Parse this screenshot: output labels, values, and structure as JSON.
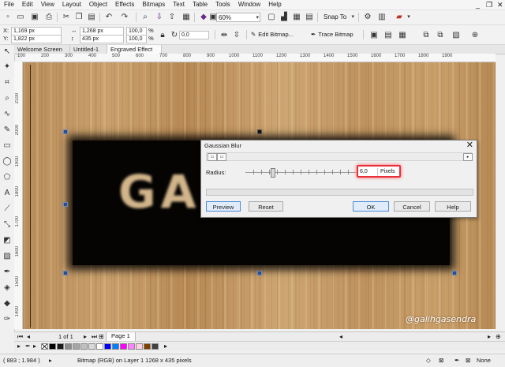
{
  "menu": [
    "File",
    "Edit",
    "View",
    "Layout",
    "Object",
    "Effects",
    "Bitmaps",
    "Text",
    "Table",
    "Tools",
    "Window",
    "Help"
  ],
  "window_controls": {
    "minimize": "_",
    "restore": "❐",
    "close": "✕"
  },
  "toolbar": {
    "zoom_value": "60%",
    "snap_label": "Snap To"
  },
  "property_bar": {
    "x": "1,169 px",
    "y": "1,822 px",
    "w": "1,268 px",
    "h": "435 px",
    "scale_w": "100,0",
    "scale_h": "100,0",
    "pct_sign": "%",
    "rotation": "0,0",
    "edit_bitmap": "Edit Bitmap...",
    "trace_bitmap": "Trace Bitmap"
  },
  "document_tabs": [
    "Welcome Screen",
    "Untitled-1",
    "Engraved Effect"
  ],
  "ruler_h": [
    "100",
    "200",
    "300",
    "400",
    "500",
    "600",
    "700",
    "800",
    "900",
    "1000",
    "1100",
    "1200",
    "1300",
    "1400",
    "1500",
    "1600",
    "1700",
    "1800",
    "1900"
  ],
  "ruler_v": [
    "2100",
    "2000",
    "1900",
    "1800",
    "1700",
    "1600",
    "1500",
    "1400"
  ],
  "canvas": {
    "art_text": "GASENDRA",
    "watermark": "@galihgasendra"
  },
  "dialog": {
    "title": "Gaussian Blur",
    "radius_label": "Radius:",
    "radius_value": "6,0",
    "radius_unit": "Pixels",
    "buttons": {
      "preview": "Preview",
      "reset": "Reset",
      "ok": "OK",
      "cancel": "Cancel",
      "help": "Help"
    }
  },
  "page_nav": {
    "counter": "1 of 1",
    "page_tab": "Page 1"
  },
  "palette_colors": [
    "#ffffff",
    "#000000",
    "#1a1a1a",
    "#8c8c8c",
    "#a6a6a6",
    "#c0c0c0",
    "#d9d9d9",
    "#ffffff",
    "#0000ff",
    "#0080ff",
    "#ff00ff",
    "#ff80ff",
    "#ffd0e0",
    "#804000",
    "#404040"
  ],
  "status": {
    "coords": "( 883 ; 1.984 )",
    "object_info": "Bitmap (RGB) on Layer 1 1268 x 435 pixels",
    "fill_none": "None"
  }
}
